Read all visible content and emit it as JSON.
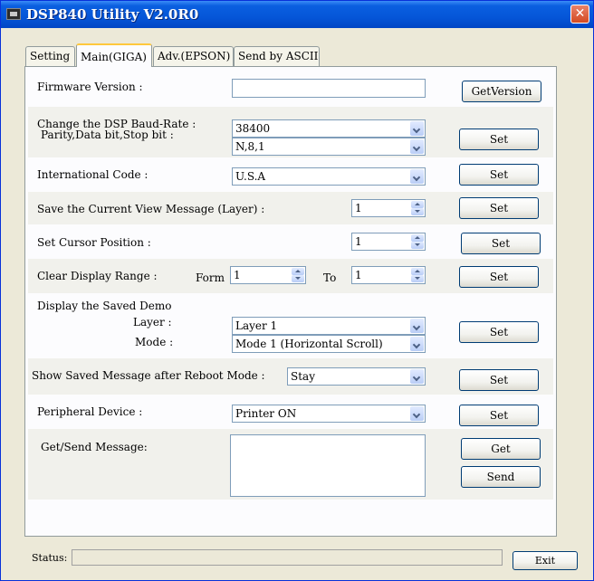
{
  "window": {
    "title": "DSP840 Utility V2.0R0",
    "close_glyph": "✕"
  },
  "tabs": [
    {
      "label": "Setting"
    },
    {
      "label": "Main(GIGA)"
    },
    {
      "label": "Adv.(EPSON)"
    },
    {
      "label": "Send by ASCII"
    }
  ],
  "firmware": {
    "label": "Firmware Version :",
    "value": "",
    "button": "GetVersion"
  },
  "baud": {
    "label1": "Change the DSP Baud-Rate :",
    "label2": "Parity,Data bit,Stop bit :",
    "rate": "38400",
    "parity": "N,8,1",
    "button": "Set"
  },
  "intl": {
    "label": "International Code :",
    "value": "U.S.A",
    "button": "Set"
  },
  "save_view": {
    "label": "Save the Current View Message (Layer) :",
    "value": "1",
    "button": "Set"
  },
  "cursor": {
    "label": "Set Cursor Position :",
    "value": "1",
    "button": "Set"
  },
  "clear": {
    "label": "Clear Display Range :",
    "from_label": "Form",
    "from_value": "1",
    "to_label": "To",
    "to_value": "1",
    "button": "Set"
  },
  "demo": {
    "label": "Display the Saved Demo",
    "layer_label": "Layer :",
    "layer_value": "Layer 1",
    "mode_label": "Mode :",
    "mode_value": "Mode 1 (Horizontal Scroll)",
    "button": "Set"
  },
  "reboot": {
    "label": "Show Saved Message after Reboot Mode :",
    "value": "Stay",
    "button": "Set"
  },
  "peripheral": {
    "label": "Peripheral Device :",
    "value": "Printer ON",
    "button": "Set"
  },
  "message": {
    "label": "Get/Send Message:",
    "value": "",
    "get_button": "Get",
    "send_button": "Send"
  },
  "status": {
    "label": "Status:",
    "value": "",
    "exit_button": "Exit"
  }
}
